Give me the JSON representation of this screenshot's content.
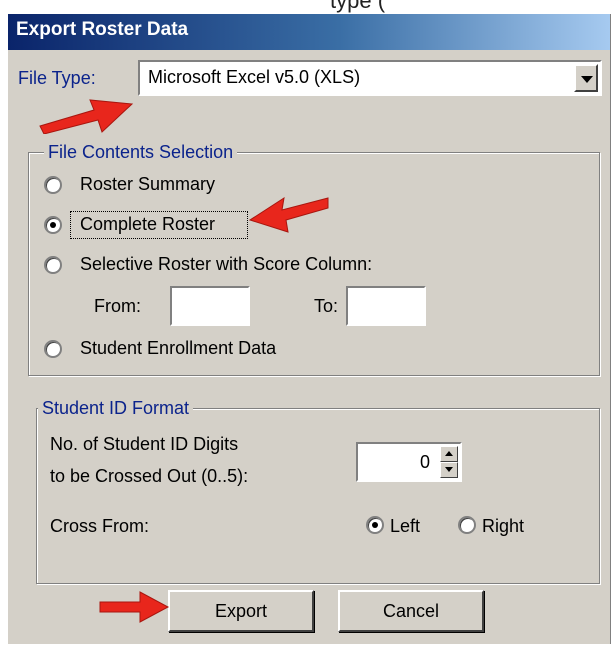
{
  "top_strip_text": "type (",
  "dialog": {
    "title": "Export Roster Data",
    "file_type": {
      "label": "File Type:",
      "selected": "Microsoft Excel v5.0 (XLS)"
    },
    "contents": {
      "legend": "File Contents Selection",
      "options": [
        {
          "label": "Roster Summary",
          "selected": false
        },
        {
          "label": "Complete Roster",
          "selected": true
        },
        {
          "label": "Selective Roster with Score Column:",
          "selected": false
        },
        {
          "label": "Student Enrollment Data",
          "selected": false
        }
      ],
      "from_label": "From:",
      "to_label": "To:",
      "from_value": "",
      "to_value": ""
    },
    "student_id": {
      "legend": "Student ID Format",
      "digits_label_line1": "No. of Student ID Digits",
      "digits_label_line2": "to be Crossed Out (0..5):",
      "digits_value": "0",
      "cross_from_label": "Cross From:",
      "left_label": "Left",
      "right_label": "Right",
      "cross_from_selected": "Left"
    },
    "buttons": {
      "export": "Export",
      "cancel": "Cancel"
    }
  },
  "colors": {
    "arrow": "#e8261c",
    "title_bar": "#0a246a",
    "dialog_bg": "#d4d0c8",
    "group_text": "#0b238c"
  }
}
